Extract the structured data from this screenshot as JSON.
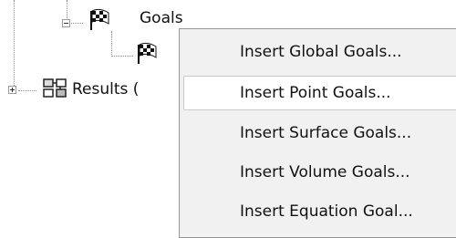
{
  "tree": {
    "goals": {
      "label": "Goals",
      "icon": "checkered-flag-icon",
      "expanded": true
    },
    "goal_child": {
      "icon": "checkered-flag-icon"
    },
    "results": {
      "label": "Results (",
      "icon": "results-icon",
      "expanded": false
    }
  },
  "menu": {
    "items": [
      {
        "label": "Insert Global Goals...",
        "hover": false
      },
      {
        "label": "Insert Point Goals...",
        "hover": true
      },
      {
        "label": "Insert Surface Goals...",
        "hover": false
      },
      {
        "label": "Insert Volume Goals...",
        "hover": false
      },
      {
        "label": "Insert Equation Goal...",
        "hover": false
      }
    ]
  }
}
